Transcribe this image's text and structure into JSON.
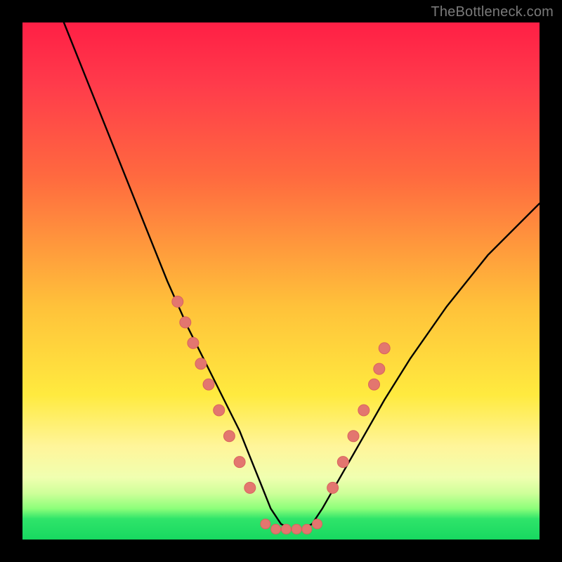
{
  "watermark": "TheBottleneck.com",
  "chart_data": {
    "type": "line",
    "title": "",
    "xlabel": "",
    "ylabel": "",
    "xlim": [
      0,
      100
    ],
    "ylim": [
      0,
      100
    ],
    "series": [
      {
        "name": "curve",
        "x": [
          8,
          12,
          16,
          20,
          24,
          28,
          32,
          36,
          40,
          42,
          44,
          46,
          48,
          50,
          52,
          54,
          56,
          58,
          62,
          66,
          70,
          75,
          82,
          90,
          100
        ],
        "y": [
          100,
          90,
          80,
          70,
          60,
          50,
          41,
          33,
          25,
          21,
          16,
          11,
          6,
          3,
          2,
          2,
          3,
          6,
          13,
          20,
          27,
          35,
          45,
          55,
          65
        ]
      }
    ],
    "markers": {
      "left_branch": [
        {
          "x": 30,
          "y": 46
        },
        {
          "x": 31.5,
          "y": 42
        },
        {
          "x": 33,
          "y": 38
        },
        {
          "x": 34.5,
          "y": 34
        },
        {
          "x": 36,
          "y": 30
        },
        {
          "x": 38,
          "y": 25
        },
        {
          "x": 40,
          "y": 20
        },
        {
          "x": 42,
          "y": 15
        },
        {
          "x": 44,
          "y": 10
        }
      ],
      "right_branch": [
        {
          "x": 60,
          "y": 10
        },
        {
          "x": 62,
          "y": 15
        },
        {
          "x": 64,
          "y": 20
        },
        {
          "x": 66,
          "y": 25
        },
        {
          "x": 68,
          "y": 30
        },
        {
          "x": 69,
          "y": 33
        },
        {
          "x": 70,
          "y": 37
        }
      ],
      "flat_bottom": [
        {
          "x": 47,
          "y": 3
        },
        {
          "x": 49,
          "y": 2
        },
        {
          "x": 51,
          "y": 2
        },
        {
          "x": 53,
          "y": 2
        },
        {
          "x": 55,
          "y": 2
        },
        {
          "x": 57,
          "y": 3
        }
      ]
    },
    "colors": {
      "curve": "#000000",
      "marker_fill": "#e3766f",
      "marker_stroke": "#d9645d"
    }
  }
}
